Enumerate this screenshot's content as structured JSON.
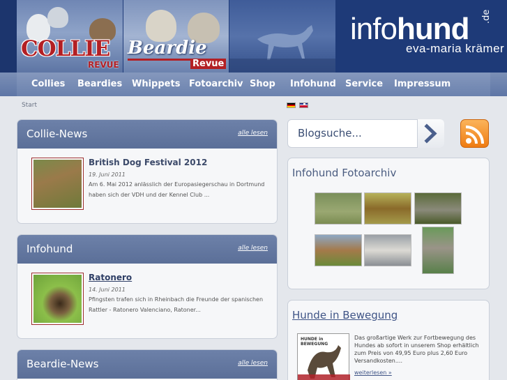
{
  "header": {
    "collie_title": "COLLIE",
    "collie_sub": "REVUE",
    "beardie_title": "Beardie",
    "beardie_sub": "Revue",
    "logo_light": "info",
    "logo_bold": "hund",
    "logo_tld": ".de",
    "logo_sub": "eva-maria krämer"
  },
  "nav": {
    "items": [
      "Collies",
      "Beardies",
      "Whippets",
      "Fotoarchiv",
      "Shop",
      "Infohund",
      "Service",
      "Impressum"
    ]
  },
  "breadcrumb": "Start",
  "boxes": [
    {
      "title": "Collie-News",
      "more": "alle lesen",
      "article_title": "British Dog Festival 2012",
      "date": "19. Juni 2011",
      "text": "Am 6. Mai 2012 anlässlich der Europasiegerschau in Dortmund haben sich der VDH und der Kennel Club ..."
    },
    {
      "title": "Infohund",
      "more": "alle lesen",
      "article_title": "Ratonero",
      "date": "14. Juni 2011",
      "text": "Pfingsten trafen sich in Rheinbach die Freunde der spanischen Rattler - Ratonero Valenciano, Ratoner..."
    },
    {
      "title": "Beardie-News",
      "more": "alle lesen"
    }
  ],
  "search": {
    "placeholder": "Blogsuche..."
  },
  "fotoarchiv": {
    "title": "Infohund Fotoarchiv"
  },
  "bewegung": {
    "title": "Hunde in Bewegung",
    "book_label": "HUNDE in BEWEGUNG",
    "text": "Das großartige Werk zur Fortbewegung des Hundes ab sofort in unserem Shop erhältlich zum Preis von 49,95 Euro plus 2,60 Euro Versandkosten....",
    "more": "weiterlesen »"
  },
  "icons": {
    "search_arrow": "chevron-right-icon",
    "rss": "rss-icon"
  },
  "colors": {
    "header_bg": "#1e3a78",
    "nav_bg": "#6b82ae",
    "box_head": "#5b6f98",
    "accent_red": "#b31f24",
    "rss_orange": "#ee7b12"
  }
}
